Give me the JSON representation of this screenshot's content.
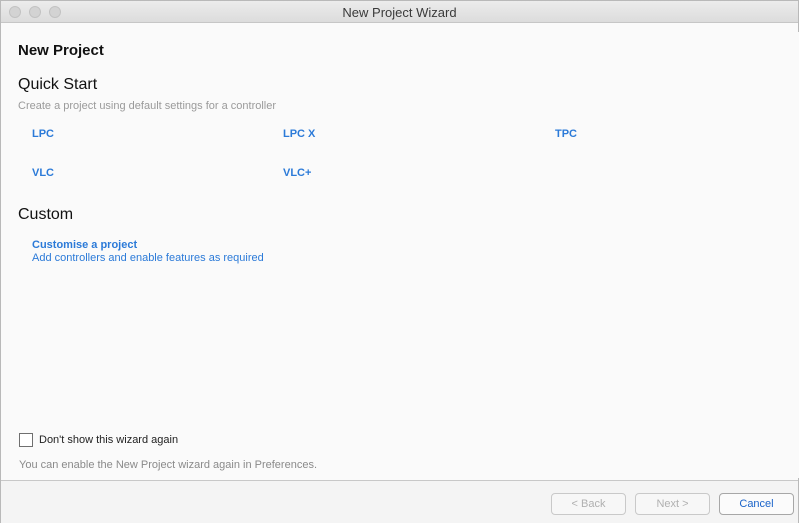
{
  "window": {
    "title": "New Project Wizard"
  },
  "page": {
    "heading": "New Project"
  },
  "quick_start": {
    "title": "Quick Start",
    "description": "Create a project using default settings for a controller",
    "controllers": [
      "LPC",
      "LPC X",
      "TPC",
      "VLC",
      "VLC+"
    ]
  },
  "custom": {
    "title": "Custom",
    "link_label": "Customise a project",
    "link_description": "Add controllers and enable features as required"
  },
  "options": {
    "dont_show_label": "Don't show this wizard again",
    "dont_show_checked": false,
    "hint": "You can enable the New Project wizard again in Preferences."
  },
  "footer": {
    "back_label": "< Back",
    "next_label": "Next >",
    "cancel_label": "Cancel"
  },
  "colors": {
    "link": "#2b7ad8",
    "cancel_text": "#1a63c9",
    "disabled_text": "#b0b0b0"
  }
}
